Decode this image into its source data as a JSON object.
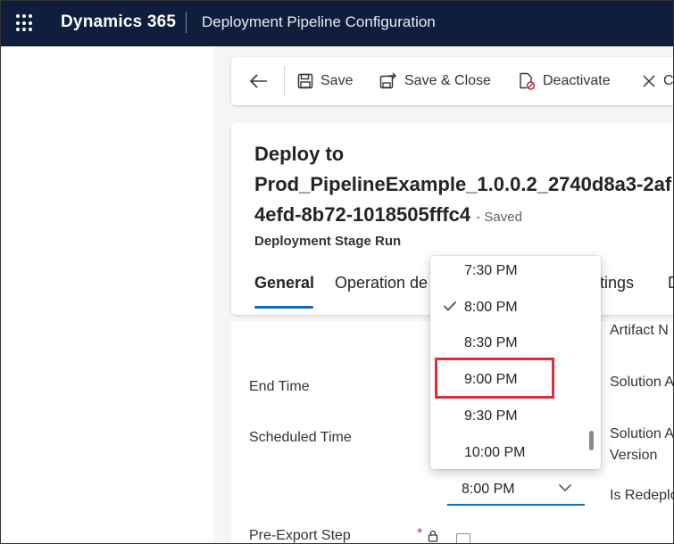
{
  "header": {
    "brand": "Dynamics 365",
    "app_title": "Deployment Pipeline Configuration"
  },
  "commands": {
    "save": "Save",
    "save_close": "Save & Close",
    "deactivate": "Deactivate",
    "close_partial": "C"
  },
  "record": {
    "title_line1": "Deploy to",
    "title_line2": "Prod_PipelineExample_1.0.0.2_2740d8a3-2af",
    "title_line3": "4efd-8b72-1018505fffc4",
    "saved": "- Saved",
    "entity": "Deployment Stage Run"
  },
  "tabs": {
    "general": "General",
    "operation": "Operation de",
    "settings": "ttings",
    "more": "D"
  },
  "fields": {
    "end_time": "End Time",
    "scheduled_time": "Scheduled Time",
    "pre_export": "Pre-Export Step",
    "required_mark": "*",
    "artifact": "Artifact N",
    "solution_a": "Solution A",
    "solution_b": "Solution A",
    "version": "Version",
    "redeploy": "Is Redeplo"
  },
  "time_select": {
    "value": "8:00 PM"
  },
  "time_options": [
    "7:30 PM",
    "8:00 PM",
    "8:30 PM",
    "9:00 PM",
    "9:30 PM",
    "10:00 PM"
  ],
  "selected_option": "8:00 PM",
  "highlighted_option": "9:00 PM",
  "colors": {
    "header_bg": "#0f1e3d",
    "accent": "#0f6cbd",
    "highlight_box": "#d9303a"
  }
}
